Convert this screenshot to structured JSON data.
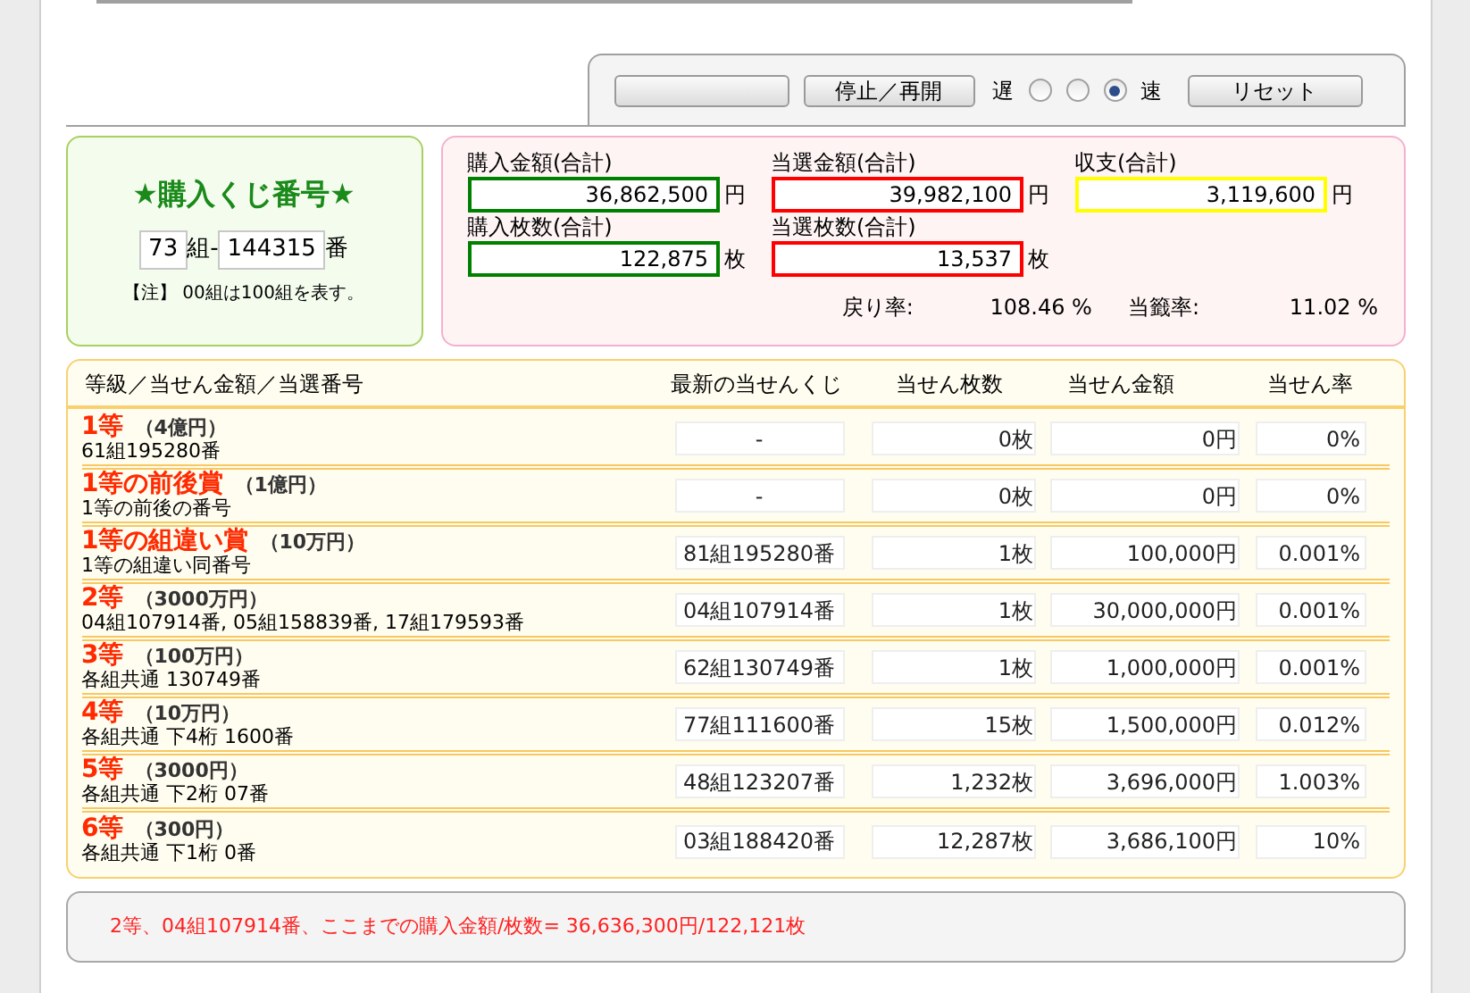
{
  "controls": {
    "buttons": [
      {
        "kind": "blank"
      },
      {
        "kind": "text",
        "label": "停止／再開"
      }
    ],
    "slow_label": "遅",
    "fast_label": "速",
    "speeds": [
      {
        "selected": false
      },
      {
        "selected": false
      },
      {
        "selected": true
      }
    ],
    "reset": "リセット"
  },
  "ticket": {
    "title": "★購入くじ番号★",
    "group": "73",
    "group_suffix": "組-",
    "number": "144315",
    "number_suffix": "番",
    "note": "【注】 00組は100組を表す。"
  },
  "totals": [
    {
      "label": "購入金額(合計)",
      "value": "36,862,500",
      "unit": "円",
      "color": "#008000"
    },
    {
      "label": "当選金額(合計)",
      "value": "39,982,100",
      "unit": "円",
      "color": "#ff0000"
    },
    {
      "label": "収支(合計)",
      "value": "3,119,600",
      "unit": "円",
      "color": "#ffff00"
    },
    {
      "label": "購入枚数(合計)",
      "value": "122,875",
      "unit": "枚",
      "color": "#008000"
    },
    {
      "label": "当選枚数(合計)",
      "value": "13,537",
      "unit": "枚",
      "color": "#ff0000"
    }
  ],
  "rates": [
    {
      "label": "戻り率:",
      "value": "108.46 %"
    },
    {
      "label": "当籤率:",
      "value": "11.02 %"
    }
  ],
  "table": {
    "columns": [
      "等級／当せん金額／当選番号",
      "最新の当せんくじ",
      "当せん枚数",
      "当せん金額",
      "当せん率"
    ],
    "rows": [
      {
        "prize": "1等",
        "amount": "（4億円）",
        "numbers": "61組195280番",
        "latest": "-",
        "count": "0枚",
        "total": "0円",
        "rate": "0%"
      },
      {
        "prize": "1等の前後賞",
        "amount": "（1億円）",
        "numbers": "1等の前後の番号",
        "latest": "-",
        "count": "0枚",
        "total": "0円",
        "rate": "0%"
      },
      {
        "prize": "1等の組違い賞",
        "amount": "（10万円）",
        "numbers": "1等の組違い同番号",
        "latest": "81組195280番",
        "count": "1枚",
        "total": "100,000円",
        "rate": "0.001%"
      },
      {
        "prize": "2等",
        "amount": "（3000万円）",
        "numbers": "04組107914番, 05組158839番, 17組179593番",
        "latest": "04組107914番",
        "count": "1枚",
        "total": "30,000,000円",
        "rate": "0.001%"
      },
      {
        "prize": "3等",
        "amount": "（100万円）",
        "numbers": "各組共通 130749番",
        "latest": "62組130749番",
        "count": "1枚",
        "total": "1,000,000円",
        "rate": "0.001%"
      },
      {
        "prize": "4等",
        "amount": "（10万円）",
        "numbers": "各組共通 下4桁 1600番",
        "latest": "77組111600番",
        "count": "15枚",
        "total": "1,500,000円",
        "rate": "0.012%"
      },
      {
        "prize": "5等",
        "amount": "（3000円）",
        "numbers": "各組共通 下2桁 07番",
        "latest": "48組123207番",
        "count": "1,232枚",
        "total": "3,696,000円",
        "rate": "1.003%"
      },
      {
        "prize": "6等",
        "amount": "（300円）",
        "numbers": "各組共通 下1桁 0番",
        "latest": "03組188420番",
        "count": "12,287枚",
        "total": "3,686,100円",
        "rate": "10%"
      }
    ]
  },
  "message": "2等、04組107914番、ここまでの購入金額/枚数= 36,636,300円/122,121枚"
}
